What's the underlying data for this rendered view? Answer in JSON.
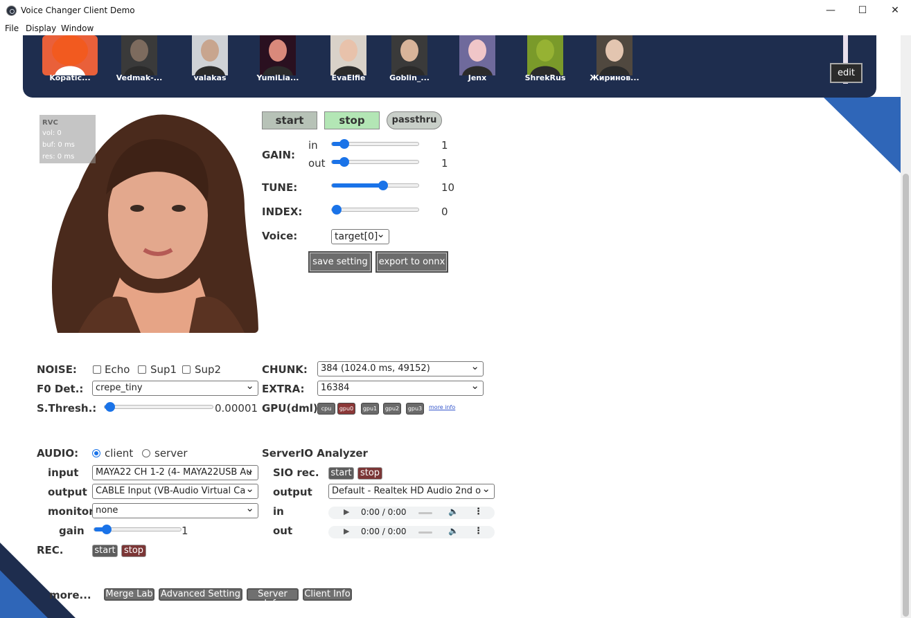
{
  "window": {
    "title": "Voice Changer Client Demo",
    "minimize": "—",
    "maximize": "☐",
    "close": "✕"
  },
  "menu": [
    "File",
    "Display",
    "Window"
  ],
  "models": [
    {
      "label": "Kopatic...",
      "color": "#e9603a",
      "skin": "#f25a1f"
    },
    {
      "label": "Vedmak-...",
      "color": "#3a3a3a",
      "skin": "#7d6b5e"
    },
    {
      "label": "valakas",
      "color": "#cfd2d6",
      "skin": "#c8a58e"
    },
    {
      "label": "YumiLia...",
      "color": "#2a1020",
      "skin": "#d9897b"
    },
    {
      "label": "EvaElfie",
      "color": "#d9d2c9",
      "skin": "#e8c2ab"
    },
    {
      "label": "Goblin_...",
      "color": "#3a3a3a",
      "skin": "#d8b49a"
    },
    {
      "label": "Jenx",
      "color": "#6f6a9c",
      "skin": "#f0c6c8"
    },
    {
      "label": "ShrekRus",
      "color": "#7a9a2a",
      "skin": "#96b233"
    },
    {
      "label": "Жиринов...",
      "color": "#50483f",
      "skin": "#e3c5b0"
    }
  ],
  "edit_label": "edit",
  "stats": {
    "title": "RVC",
    "vol": "vol: 0",
    "buf": "buf: 0 ms",
    "res": "res: 0 ms"
  },
  "controls": {
    "start": "start",
    "stop": "stop",
    "passthru": "passthru",
    "gain_label": "GAIN:",
    "in_label": "in",
    "out_label": "out",
    "gain_in": 1,
    "gain_in_text": "1",
    "gain_out": 1,
    "gain_out_text": "1",
    "tune_label": "TUNE:",
    "tune": 10,
    "tune_text": "10",
    "index_label": "INDEX:",
    "index": 0,
    "index_text": "0",
    "voice_label": "Voice:",
    "voice_value": "target[0]",
    "save_setting": "save setting",
    "export_onnx": "export to onnx"
  },
  "noise": {
    "label": "NOISE:",
    "echo": "Echo",
    "sup1": "Sup1",
    "sup2": "Sup2"
  },
  "f0": {
    "label": "F0 Det.:",
    "value": "crepe_tiny"
  },
  "sthresh": {
    "label": "S.Thresh.:",
    "value_text": "0.00001",
    "value": 1e-05
  },
  "chunk": {
    "label": "CHUNK:",
    "value": "384 (1024.0 ms, 49152)"
  },
  "extra": {
    "label": "EXTRA:",
    "value": "16384"
  },
  "gpu": {
    "label": "GPU(dml)",
    "buttons": [
      "cpu",
      "gpu0",
      "gpu1",
      "gpu2",
      "gpu3"
    ],
    "active": "gpu0",
    "more_info": "more info"
  },
  "audio": {
    "label": "AUDIO:",
    "client": "client",
    "server": "server",
    "input_label": "input",
    "input_value": "MAYA22 CH 1-2 (4- MAYA22USB Au",
    "output_label": "output",
    "output_value": "CABLE Input (VB-Audio Virtual Ca",
    "monitor_label": "monitor",
    "monitor_value": "none",
    "gain_label": "gain",
    "gain_text": "1",
    "gain": 1,
    "rec_label": "REC.",
    "rec_start": "start",
    "rec_stop": "stop"
  },
  "serverio": {
    "title": "ServerIO Analyzer",
    "sio_label": "SIO rec.",
    "sio_start": "start",
    "sio_stop": "stop",
    "output_label": "output",
    "output_value": "Default - Realtek HD Audio 2nd o",
    "in_label": "in",
    "out_label": "out",
    "time": "0:00 / 0:00"
  },
  "more": {
    "label": "more...",
    "buttons": [
      "Merge Lab",
      "Advanced Setting",
      "Server Info",
      "Client Info"
    ]
  }
}
